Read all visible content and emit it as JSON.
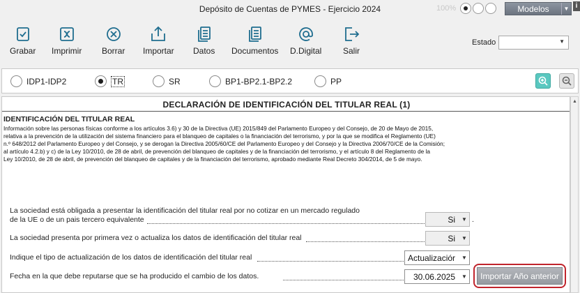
{
  "window": {
    "title": "Depósito de Cuentas de PYMES - Ejercicio 2024",
    "zoom": "100%",
    "modelos_label": "Modelos",
    "info_label": "i"
  },
  "toolbar": {
    "items": [
      {
        "label": "Grabar",
        "icon": "save-icon"
      },
      {
        "label": "Imprimir",
        "icon": "print-icon"
      },
      {
        "label": "Borrar",
        "icon": "delete-icon"
      },
      {
        "label": "Importar",
        "icon": "import-icon"
      },
      {
        "label": "Datos",
        "icon": "data-icon"
      },
      {
        "label": "Documentos",
        "icon": "documents-icon"
      },
      {
        "label": "D.Digital",
        "icon": "at-icon"
      },
      {
        "label": "Salir",
        "icon": "exit-icon"
      }
    ],
    "estado_label": "Estado",
    "estado_value": ""
  },
  "models": {
    "options": [
      "IDP1-IDP2",
      "TR",
      "SR",
      "BP1-BP2.1-BP2.2",
      "PP"
    ],
    "selected": "TR"
  },
  "document": {
    "title": "DECLARACIÓN DE IDENTIFICACIÓN DEL TITULAR REAL (1)",
    "section_title": "IDENTIFICACIÓN DEL TITULAR REAL",
    "body_lines": [
      "Información sobre las personas físicas conforme a los artículos 3.6) y 30 de la Directiva (UE) 2015/849 del Parlamento Europeo y del Consejo, de 20 de Mayo de 2015,",
      "relativa a la prevención de la utilización del sistema financiero para el blanqueo de capitales o la financiación  del terrorismo, y por la que se modifica el Reglamento (UE)",
      "n.º 648/2012 del Parlamento Europeo y del Consejo, y se derogan la Directiva 2005/60/CE del Parlamento Europeo y del Consejo y la Directiva 2006/70/CE de la Comisión;",
      "al artículo 4.2.b) y c) de la Ley 10/2010, de 28 de abril, de prevención del blanqueo de capitales y de la financiación del terrorismo, y el artículo 8 del Reglamento de la",
      "Ley 10/2010, de 28 de abril, de prevención del blanqueo de capitales y de la financiación del terrorismo, aprobado mediante Real Decreto 304/2014, de 5 de mayo."
    ],
    "questions": [
      {
        "line1": "La sociedad está obligada a presentar la identificación del titular real por no cotizar en un mercado regulado",
        "line2": "de la UE o de un pais tercero equivalente",
        "value": "Si"
      },
      {
        "line1": "La sociedad presenta por primera vez o actualiza los datos de identificación del titular real",
        "value": "Si"
      },
      {
        "line1": "Indique el tipo de actualización de los datos de identificación del titular real",
        "value": "Actualizaciór"
      },
      {
        "line1": "Fecha en la que debe reputarse que se ha producido el cambio de los datos.",
        "value": "30.06.2025"
      }
    ],
    "import_button": "Importar Año anterior"
  }
}
